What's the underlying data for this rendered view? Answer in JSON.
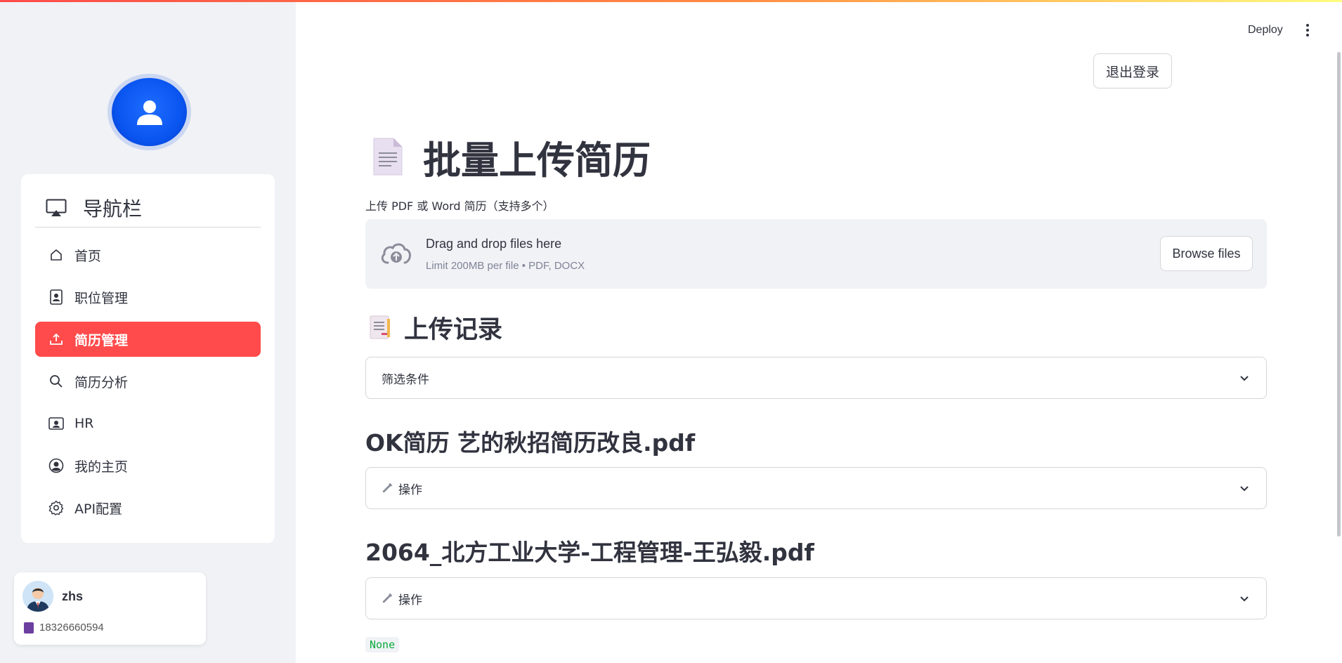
{
  "header": {
    "deploy_label": "Deploy",
    "logout_label": "退出登录"
  },
  "sidebar": {
    "nav_title": "导航栏",
    "items": [
      {
        "label": "首页",
        "icon": "house-icon"
      },
      {
        "label": "职位管理",
        "icon": "person-badge-icon"
      },
      {
        "label": "简历管理",
        "icon": "upload-icon",
        "active": true
      },
      {
        "label": "简历分析",
        "icon": "search-icon"
      },
      {
        "label": "HR",
        "icon": "person-video-icon"
      },
      {
        "label": "我的主页",
        "icon": "person-circle-icon"
      },
      {
        "label": "API配置",
        "icon": "gear-icon"
      }
    ],
    "user": {
      "name": "zhs",
      "phone": "18326660594"
    }
  },
  "main": {
    "title": "批量上传简历",
    "uploader": {
      "label": "上传 PDF 或 Word 简历（支持多个）",
      "drop_text": "Drag and drop files here",
      "limit_text": "Limit 200MB per file • PDF, DOCX",
      "browse_label": "Browse files"
    },
    "records_title": "上传记录",
    "filter_label": "筛选条件",
    "files": [
      {
        "name": "OK简历 艺的秋招简历改良.pdf",
        "action_label": "操作"
      },
      {
        "name": "2064_北方工业大学-工程管理-王弘毅.pdf",
        "action_label": "操作"
      }
    ],
    "trailing_output": "None"
  },
  "colors": {
    "accent": "#ff4b4b",
    "sidebar_bg": "#f0f2f6",
    "logo_blue": "#0a55f0",
    "code_green": "#09ab3b"
  }
}
